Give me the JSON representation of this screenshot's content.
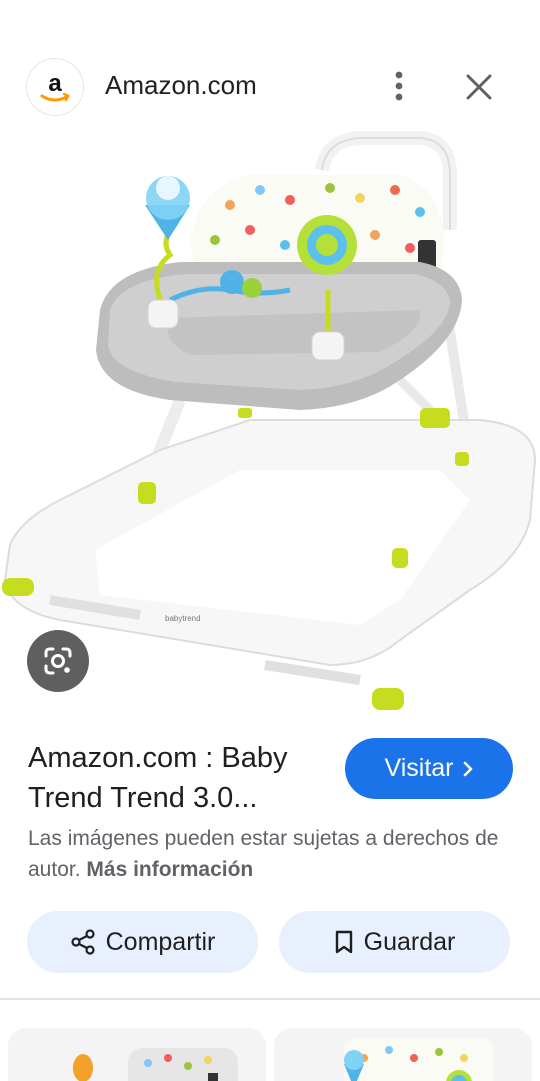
{
  "header": {
    "site_logo_letter": "a",
    "site_name": "Amazon.com"
  },
  "product": {
    "image_name": "baby-walker-image",
    "brand_mark": "babytrend"
  },
  "info": {
    "title_line1": "Amazon.com : Baby",
    "title_line2": "Trend Trend 3.0...",
    "visit_label": "Visitar",
    "notice_text": "Las imágenes pueden estar sujetas a derechos de autor.",
    "notice_link": "Más información"
  },
  "actions": {
    "share_label": "Compartir",
    "save_label": "Guardar"
  },
  "colors": {
    "accent": "#1a73e8",
    "pill_bg": "#e8f0fe",
    "lens_bg": "#5f5f5f",
    "amazon_orange": "#ff9900"
  }
}
